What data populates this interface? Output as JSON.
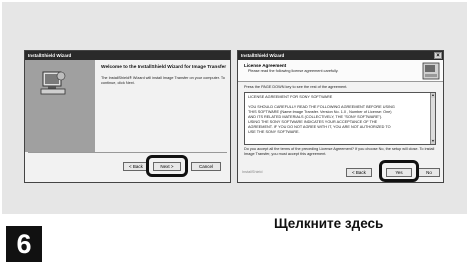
{
  "left_dialog": {
    "title": "InstallShield Wizard",
    "heading": "Welcome to the InstallShield Wizard for Image Transfer",
    "body": "The InstallShield® Wizard will install Image Transfer on your computer. To continue, click Next.",
    "back_label": "< Back",
    "next_label": "Next >",
    "cancel_label": "Cancel"
  },
  "right_dialog": {
    "title": "InstallShield Wizard",
    "header_title": "License Agreement",
    "header_sub": "Please read the following license agreement carefully.",
    "instruction": "Press the PAGE DOWN key to see the rest of the agreement.",
    "license_lines": [
      "LICENSE AGREEMENT FOR SONY SOFTWARE",
      "",
      "YOU SHOULD CAREFULLY READ THE FOLLOWING AGREEMENT BEFORE USING",
      "THIS SOFTWARE (Name:Image Transfer. Version No. 1.0 , Number of License: One)",
      "AND ITS RELATED MATERIALS (COLLECTIVELY, THE \"SONY SOFTWARE\").",
      "USING THE SONY SOFTWARE INDICATES YOUR ACCEPTANCE OF THE",
      "AGREEMENT. IF YOU DO NOT AGREE WITH IT, YOU ARE NOT AUTHORIZED TO",
      "USE THE SONY SOFTWARE."
    ],
    "question": "Do you accept all the terms of the preceding License Agreement? If you choose No, the setup will close. To install Image Transfer, you must accept this agreement.",
    "footer_brand": "InstallShield",
    "back_label": "< Back",
    "yes_label": "Yes",
    "no_label": "No"
  },
  "caption": "Щелкните здесь",
  "step_number": "6"
}
